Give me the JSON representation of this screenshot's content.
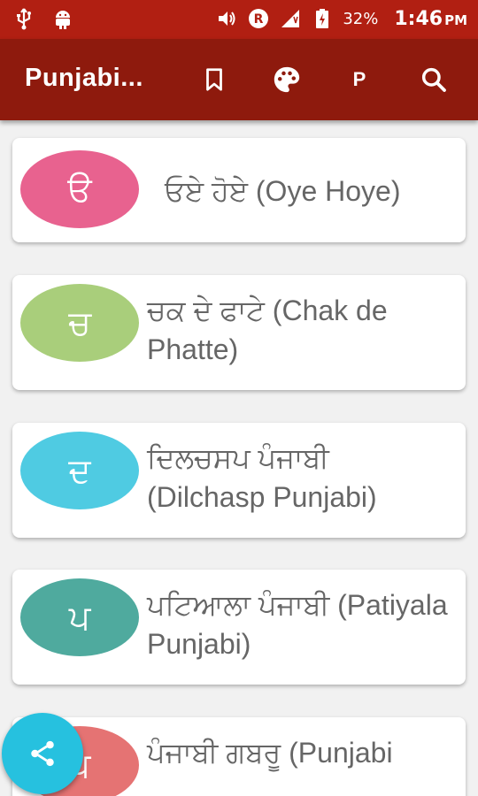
{
  "status": {
    "battery": "32%",
    "time": "1:46",
    "ampm": "PM",
    "roaming_letter": "R"
  },
  "appbar": {
    "title": "Punjabi...",
    "p_button": "P",
    "icons": [
      "bookmark-icon",
      "palette-icon",
      "search-icon"
    ]
  },
  "items": [
    {
      "letter": "ੳ",
      "title": "ਓਏ ਹੋਏ  (Oye Hoye)",
      "color": "#e8628f"
    },
    {
      "letter": "ਚ",
      "title": "ਚਕ ਦੇ ਫਾਟੇ (Chak de Phatte)",
      "color": "#a9ce7b"
    },
    {
      "letter": "ਦ",
      "title": "ਦਿਲਚਸਪ ਪੰਜਾਬੀ (Dilchasp Punjabi)",
      "color": "#4fcbe2"
    },
    {
      "letter": "ਪ",
      "title": "ਪਟਿਆਲਾ ਪੰਜਾਬੀ (Patiyala Punjabi)",
      "color": "#4faa9e"
    },
    {
      "letter": "ਪ",
      "title": "ਪੰਜਾਬੀ ਗਬਰੂ  (Punjabi",
      "color": "#e57373"
    }
  ],
  "colors": {
    "status_bar": "#b11f12",
    "app_bar": "#8e1a0d",
    "fab": "#26c1df"
  }
}
